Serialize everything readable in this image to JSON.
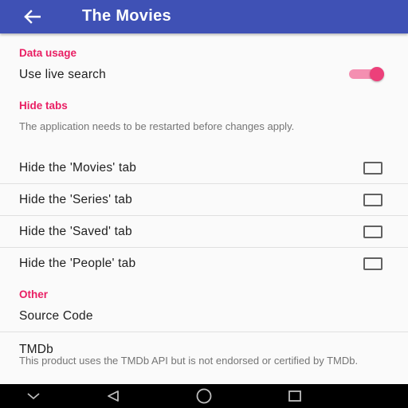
{
  "appbar": {
    "title": "The Movies",
    "back_icon": "arrow-left-icon"
  },
  "colors": {
    "primary": "#3f51b5",
    "accent": "#e91e63",
    "switch_thumb": "#ec407a",
    "switch_track": "#f48fb1"
  },
  "sections": {
    "data_usage": {
      "header": "Data usage",
      "live_search": {
        "label": "Use live search",
        "enabled": true
      }
    },
    "hide_tabs": {
      "header": "Hide tabs",
      "note": "The application needs to be restarted before changes apply.",
      "items": [
        {
          "label": "Hide the 'Movies' tab",
          "checked": false
        },
        {
          "label": "Hide the 'Series' tab",
          "checked": false
        },
        {
          "label": "Hide the 'Saved' tab",
          "checked": false
        },
        {
          "label": "Hide the 'People' tab",
          "checked": false
        }
      ]
    },
    "other": {
      "header": "Other",
      "source_code": {
        "label": "Source Code"
      },
      "tmdb": {
        "title": "TMDb",
        "summary": "This product uses the TMDb API but is not endorsed or certified by TMDb."
      }
    }
  },
  "navbar": {
    "icons": [
      "chevron-down-icon",
      "back-triangle-icon",
      "home-circle-icon",
      "recents-square-icon"
    ]
  }
}
